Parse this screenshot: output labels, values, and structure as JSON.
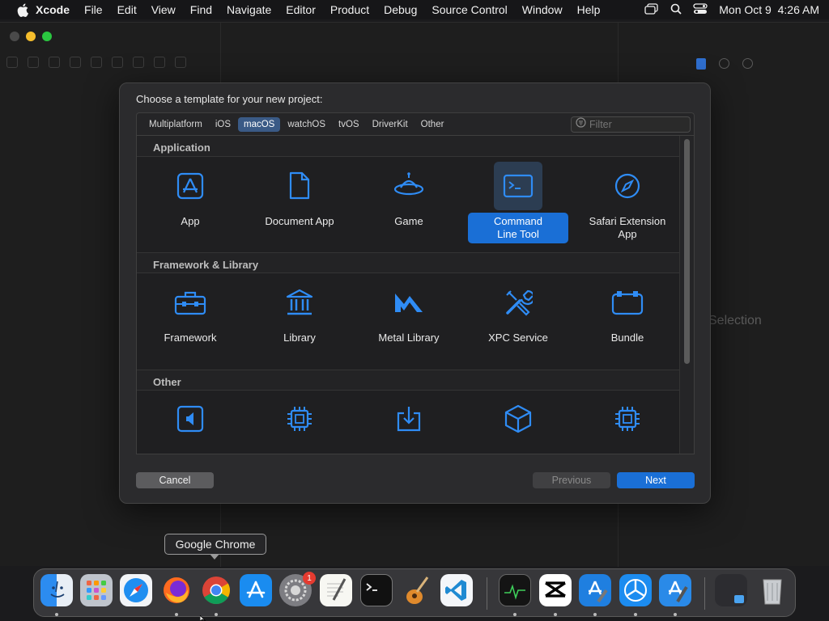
{
  "menubar": {
    "app": "Xcode",
    "items": [
      "File",
      "Edit",
      "View",
      "Find",
      "Navigate",
      "Editor",
      "Product",
      "Debug",
      "Source Control",
      "Window",
      "Help"
    ],
    "clock": "Mon Oct 9  4:26 AM"
  },
  "background": {
    "ghost_text": "Selection"
  },
  "dialog": {
    "title": "Choose a template for your new project:",
    "tabs": [
      "Multiplatform",
      "iOS",
      "macOS",
      "watchOS",
      "tvOS",
      "DriverKit",
      "Other"
    ],
    "active_tab": "macOS",
    "filter_placeholder": "Filter",
    "sections": [
      {
        "name": "Application",
        "items": [
          {
            "label": "App",
            "icon": "app-icon"
          },
          {
            "label": "Document App",
            "icon": "document-icon"
          },
          {
            "label": "Game",
            "icon": "game-icon"
          },
          {
            "label": "Command\nLine Tool",
            "icon": "terminal-icon",
            "selected": true
          },
          {
            "label": "Safari Extension\nApp",
            "icon": "safari-compass-icon"
          }
        ]
      },
      {
        "name": "Framework & Library",
        "items": [
          {
            "label": "Framework",
            "icon": "toolbox-icon"
          },
          {
            "label": "Library",
            "icon": "library-building-icon"
          },
          {
            "label": "Metal Library",
            "icon": "metal-icon"
          },
          {
            "label": "XPC Service",
            "icon": "tools-icon"
          },
          {
            "label": "Bundle",
            "icon": "bundle-icon"
          }
        ]
      },
      {
        "name": "Other",
        "items": [
          {
            "label": "",
            "icon": "audio-unit-icon"
          },
          {
            "label": "",
            "icon": "chip-icon"
          },
          {
            "label": "",
            "icon": "download-tray-icon"
          },
          {
            "label": "",
            "icon": "package-icon"
          },
          {
            "label": "",
            "icon": "chip-icon"
          }
        ]
      }
    ],
    "buttons": {
      "cancel": "Cancel",
      "previous": "Previous",
      "next": "Next"
    }
  },
  "tooltip": "Google Chrome",
  "dock": {
    "apps": [
      "Finder",
      "Launchpad",
      "Safari",
      "Firefox",
      "Google Chrome",
      "App Store",
      "System Settings",
      "TextEdit",
      "Terminal",
      "GarageBand",
      "Visual Studio Code",
      "Activity Monitor",
      "CapCut",
      "Xcode",
      "TestFlight",
      "Xcode Beta"
    ],
    "badge": "1"
  },
  "colors": {
    "accent": "#1a6fd6",
    "icon_blue": "#2f8cf5",
    "dialog_bg": "#2b2b2d"
  }
}
